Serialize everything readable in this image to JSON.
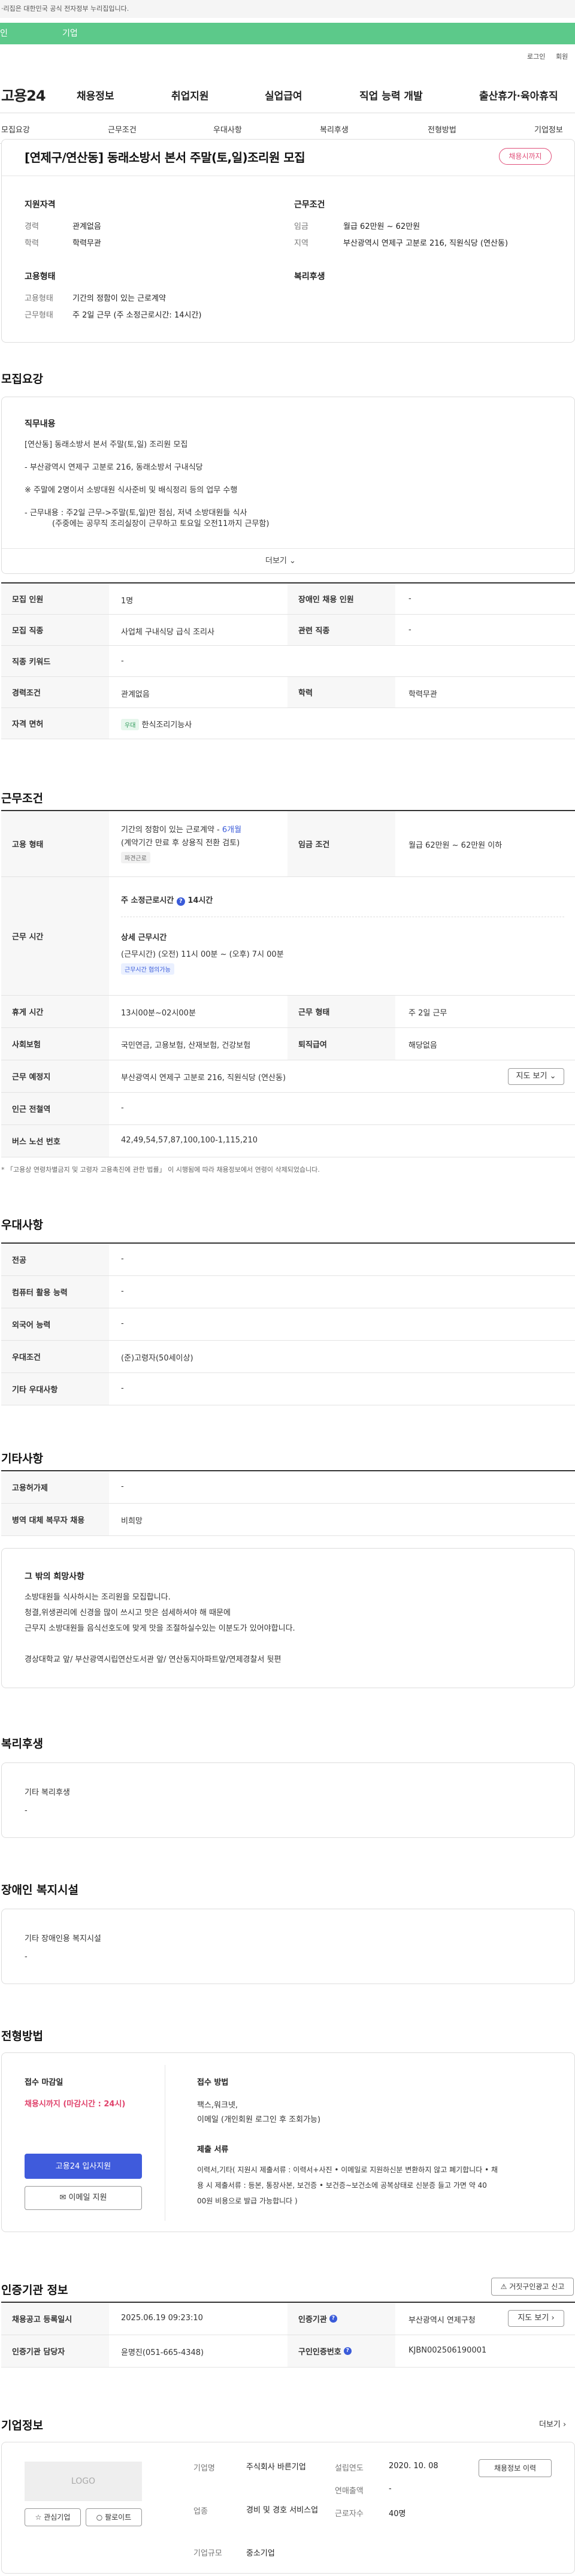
{
  "gov_banner": "이 누리집은 대한민국 공식 전자정부 누리집입니다.",
  "gov_banner_visible": "·리집은 대한민국 공식 전자정부 누리집입니다.",
  "top_tabs": [
    "인",
    "기업"
  ],
  "util": [
    "로그인",
    "회원"
  ],
  "logo": "고용24",
  "gnb": [
    "채용정보",
    "취업지원",
    "실업급여",
    "직업 능력 개발",
    "출산휴가·육아휴직"
  ],
  "anchors": [
    "모집요강",
    "근무조건",
    "우대사항",
    "복리후생",
    "전형방법",
    "기업정보"
  ],
  "title": "[연제구/연산동] 동래소방서 본서 주말(토,일)조리원 모집",
  "status_badge": "채용시까지",
  "summary": {
    "qual_title": "지원자격",
    "qual": [
      [
        "경력",
        "관계없음"
      ],
      [
        "학력",
        "학력무관"
      ]
    ],
    "cond_title": "근무조건",
    "cond": [
      [
        "임금",
        "월급 62만원 ~ 62만원"
      ],
      [
        "지역",
        "부산광역시 연제구 고분로 216, 직원식당 (연산동)"
      ]
    ],
    "emp_title": "고용형태",
    "emp": [
      [
        "고용형태",
        "기간의 정함이 있는 근로계약"
      ],
      [
        "근무형태",
        "주 2일 근무 (주 소정근로시간: 14시간)"
      ]
    ],
    "welfare_title": "복리후생"
  },
  "recruit": {
    "section": "모집요강",
    "duty_title": "직무내용",
    "duty_lines": [
      "[연산동] 동래소방서 본서 주말(토,일) 조리원 모집",
      "- 부산광역시 연제구 고분로 216, 동래소방서 구내식당",
      "※ 주말에 2명이서 소방대원 식사준비 및 배식정리 등의 업무 수행",
      "- 근무내용 : 주2일 근무->주말(토,일)만 점심, 저녁 소방대원들 식사",
      "(주중에는 공무직 조리실장이 근무하고 토요일 오전11까지 근무함)"
    ],
    "more": "더보기",
    "rows": [
      [
        "모집 인원",
        "1명",
        "장애인 채용 인원",
        "-"
      ],
      [
        "모집 직종",
        "사업체 구내식당 급식 조리사",
        "관련 직종",
        "-"
      ],
      [
        "직종 키워드",
        "-",
        "",
        ""
      ],
      [
        "경력조건",
        "관계없음",
        "학력",
        "학력무관"
      ],
      [
        "자격 면허",
        "한식조리기능사",
        "",
        ""
      ]
    ],
    "license_chip": "우대"
  },
  "work": {
    "section": "근무조건",
    "emp_label": "고용 형태",
    "emp_value": "기간의 정함이 있는 근로계약 -",
    "emp_link": "6개월",
    "emp_note": "(계약기간 만료 후 상용직 전환 검토)",
    "emp_chip": "파견근로",
    "wage_label": "임금 조건",
    "wage_value": "월급 62만원 ~ 62만원 이하",
    "time_label": "근무 시간",
    "weekly": "주 소정근로시간",
    "weekly_hours": "14시간",
    "detail_title": "상세 근무시간",
    "detail": "(근무시간) (오전) 11시 00분 ~ (오후) 7시 00분",
    "detail_chip": "근무시간 협의가능",
    "rows": [
      [
        "휴게 시간",
        "13시00분~02시00분",
        "근무 형태",
        "주 2일 근무"
      ],
      [
        "사회보험",
        "국민연금, 고용보험, 산재보험, 건강보험",
        "퇴직급여",
        "해당없음"
      ],
      [
        "근무 예정지",
        "부산광역시 연제구 고분로 216, 직원식당 (연산동)",
        "",
        ""
      ],
      [
        "인근 전철역",
        "-",
        "",
        ""
      ],
      [
        "버스 노선 번호",
        "42,49,54,57,87,100,100-1,115,210",
        "",
        ""
      ]
    ],
    "map_btn": "지도 보기",
    "footnote": "* 「고용상 연령차별금지 및 고령자 고용촉진에 관한 법률」 이 시행됨에 따라 채용정보에서 연령이 삭제되었습니다."
  },
  "pref": {
    "section": "우대사항",
    "rows": [
      [
        "전공",
        "-"
      ],
      [
        "컴퓨터 활용 능력",
        "-"
      ],
      [
        "외국어 능력",
        "-"
      ],
      [
        "우대조건",
        "(준)고령자(50세이상)"
      ],
      [
        "기타 우대사항",
        "-"
      ]
    ]
  },
  "etc": {
    "section": "기타사항",
    "rows": [
      [
        "고용허가제",
        "-"
      ],
      [
        "병역 대체 복무자 채용",
        "비희망"
      ]
    ],
    "box_title": "그 밖의 희망사항",
    "box_lines": [
      "소방대원들 식사하시는 조리원을 모집합니다.",
      "청결,위생관리에 신경을 많이 쓰시고 맛은 섬세하셔야 해 때문에",
      "근무지 소방대원들 음식선호도에 맞게 맛을 조절하실수있는 이분도가 있어야합니다.",
      "",
      "경상대학교 앞/ 부산광역시립연산도서관 앞/ 연산동지아파트앞/연제경찰서 뒷편"
    ]
  },
  "welfare": {
    "section": "복리후생",
    "label": "기타 복리후생",
    "value": "-"
  },
  "disab": {
    "section": "장애인 복지시설",
    "label": "기타 장애인용 복지시설",
    "value": "-"
  },
  "process": {
    "section": "전형방법",
    "deadline_title": "접수 마감일",
    "deadline": "채용시까지 (마감시간 : 24시)",
    "apply_btn": "고용24 입사지원",
    "email_btn": "이메일 지원",
    "method_title": "접수 방법",
    "method_lines": [
      "팩스,워크넷,",
      "이메일 (개인회원 로그인 후 조회가능)"
    ],
    "docs_title": "제출 서류",
    "docs_lines": [
      "이력서,기타( 지원시 제출서류 : 이력서+사진 • 이메일로 지원하신분 변환하지 않고 폐기합니다 • 채",
      "용 시 제출서류 : 등본, 통장사본, 보건증 • 보건증~보건소에 공복상태로 신분증 들고 가면 약 40",
      "00원 비용으로 발급 가능합니다 )"
    ]
  },
  "cert": {
    "section": "인증기관 정보",
    "report_btn": "거짓구인광고 신고",
    "rows": [
      [
        "채용공고 등록일시",
        "2025.06.19 09:23:10",
        "인증기관",
        "부산광역시 연제구청"
      ],
      [
        "인증기관 담당자",
        "윤명진(051-665-4348)",
        "구인인증번호",
        "KJBN002506190001"
      ]
    ],
    "map_btn": "지도 보기"
  },
  "company": {
    "section": "기업정보",
    "more": "더보기",
    "logo": "LOGO",
    "fav_btn": "관심기업",
    "follow_btn": "팔로이트",
    "left": [
      [
        "기업명",
        "주식회사 바른기업"
      ],
      [
        "업종",
        "경비 및 경호 서비스업"
      ],
      [
        "기업규모",
        "중소기업"
      ]
    ],
    "right": [
      [
        "설립연도",
        "2020. 10. 08"
      ],
      [
        "연매출액",
        "-"
      ],
      [
        "근로자수",
        "40명"
      ]
    ],
    "info_btn": "채용정보 이력"
  }
}
